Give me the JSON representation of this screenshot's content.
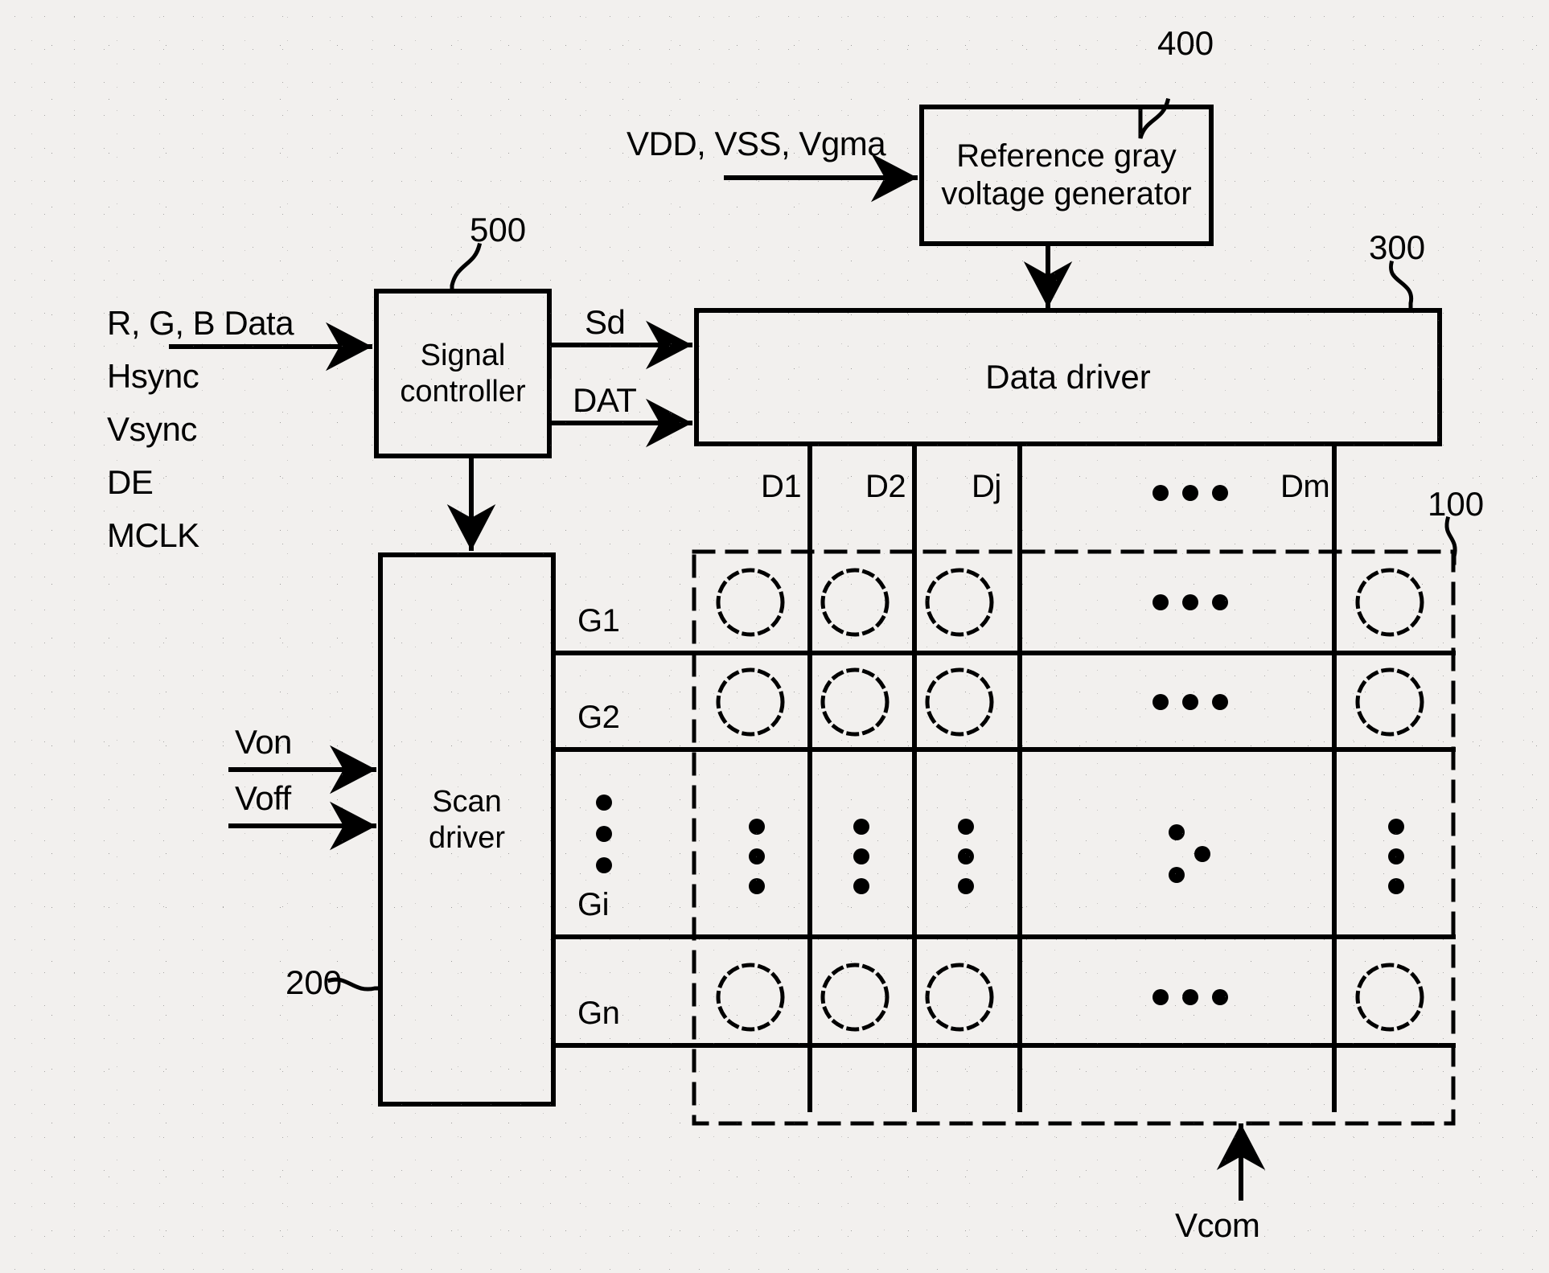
{
  "figure": {
    "type": "block-diagram",
    "title": "Display device block diagram",
    "background_color": "#f2f0ee",
    "line_color": "#000000"
  },
  "blocks": {
    "reference_gray_voltage_generator": {
      "label_line1": "Reference gray",
      "label_line2": "voltage generator",
      "ref": "400"
    },
    "signal_controller": {
      "label_line1": "Signal",
      "label_line2": "controller",
      "ref": "500"
    },
    "data_driver": {
      "label": "Data driver",
      "ref": "300"
    },
    "scan_driver": {
      "label_line1": "Scan",
      "label_line2": "driver",
      "ref": "200"
    },
    "display_panel": {
      "ref": "100"
    }
  },
  "inputs": {
    "power_signals": "VDD, VSS, Vgma",
    "controller_inputs": [
      "R, G, B Data",
      "Hsync",
      "Vsync",
      "DE",
      "MCLK"
    ],
    "scan_driver_inputs": [
      "Von",
      "Voff"
    ],
    "common_voltage": "Vcom"
  },
  "signals": {
    "sd": "Sd",
    "dat": "DAT"
  },
  "data_lines": [
    "D1",
    "D2",
    "Dj",
    "Dm"
  ],
  "gate_lines": [
    "G1",
    "G2",
    "Gi",
    "Gn"
  ],
  "ellipsis": {
    "horizontal": "• • •",
    "vertical": "•"
  }
}
